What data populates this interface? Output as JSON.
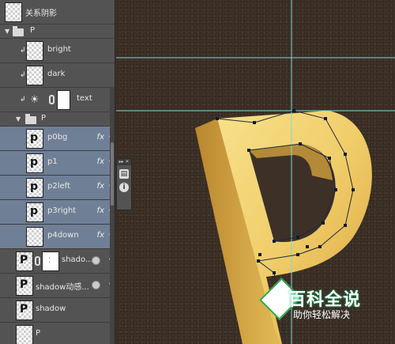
{
  "layers_panel": {
    "rows": [
      {
        "label": "关系阴影"
      },
      {
        "label": "P"
      },
      {
        "label": "bright"
      },
      {
        "label": "dark"
      },
      {
        "label": "text"
      },
      {
        "label": "P"
      },
      {
        "label": "p0bg",
        "fx": "fx"
      },
      {
        "label": "p1",
        "fx": "fx"
      },
      {
        "label": "p2left",
        "fx": "fx"
      },
      {
        "label": "p3right",
        "fx": "fx"
      },
      {
        "label": "p4down",
        "fx": "fx"
      },
      {
        "label": "shado..."
      },
      {
        "label": "shadow动感..."
      },
      {
        "label": "shadow"
      },
      {
        "label": "P"
      }
    ]
  },
  "mini_panel": {
    "header": "▸▸ ✕",
    "icon_a": "▤",
    "icon_b": "i"
  },
  "canvas": {
    "background": "#3d3127",
    "guide_color": "#7fd8d8",
    "letter_color": "#f0cd6a"
  },
  "watermark": {
    "title": "百科全说",
    "subtitle": "助你轻松解决"
  },
  "colors": {
    "panel_bg": "#535353",
    "selected_row": "#6f7f96"
  }
}
